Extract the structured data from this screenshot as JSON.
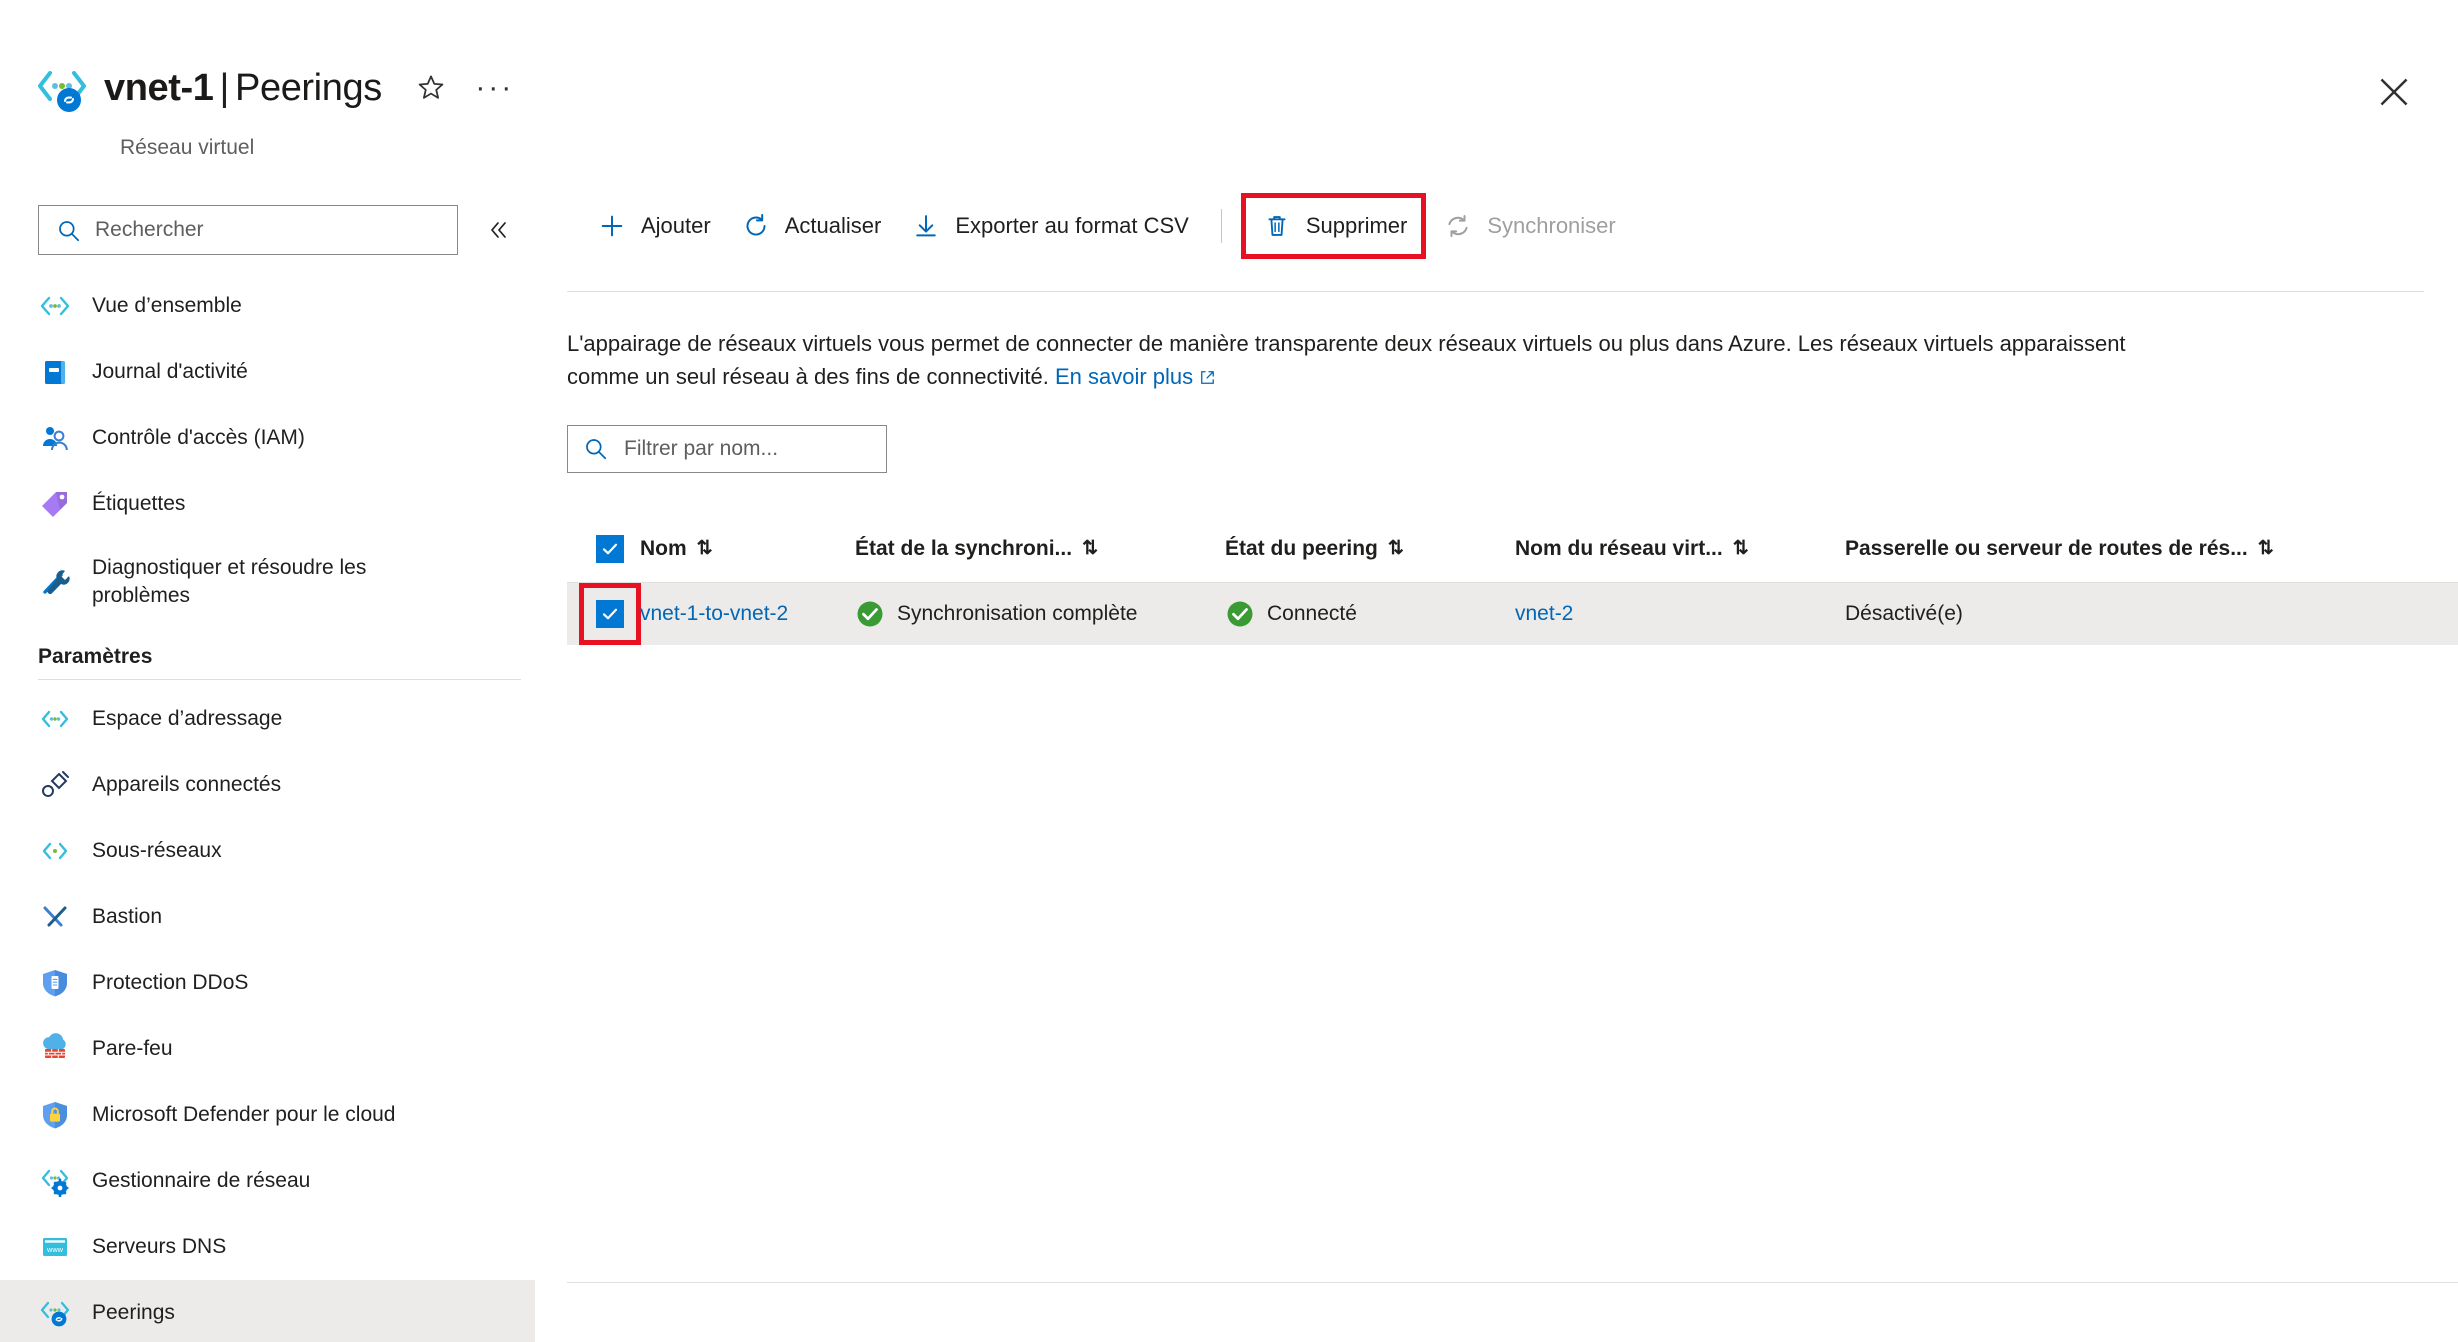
{
  "header": {
    "resource_name": "vnet-1",
    "separator": "|",
    "page_name": "Peerings",
    "subtitle": "Réseau virtuel",
    "favorite_icon": "star-icon",
    "more_icon": "ellipsis-icon",
    "close_icon": "close-icon"
  },
  "sidebar": {
    "search_placeholder": "Rechercher",
    "search_value": "",
    "collapse_icon": "double-chevron-left-icon",
    "items": [
      {
        "label": "Vue d’ensemble",
        "icon": "virtual-network-icon",
        "selected": false
      },
      {
        "label": "Journal d'activité",
        "icon": "activity-log-icon",
        "selected": false
      },
      {
        "label": "Contrôle d'accès (IAM)",
        "icon": "access-control-icon",
        "selected": false
      },
      {
        "label": "Étiquettes",
        "icon": "tag-icon",
        "selected": false
      },
      {
        "label": "Diagnostiquer et résoudre les problèmes",
        "icon": "troubleshoot-icon",
        "selected": false
      }
    ],
    "group_label": "Paramètres",
    "settings_items": [
      {
        "label": "Espace d’adressage",
        "icon": "address-space-icon",
        "selected": false
      },
      {
        "label": "Appareils connectés",
        "icon": "connected-devices-icon",
        "selected": false
      },
      {
        "label": "Sous-réseaux",
        "icon": "subnet-icon",
        "selected": false
      },
      {
        "label": "Bastion",
        "icon": "bastion-icon",
        "selected": false
      },
      {
        "label": "Protection DDoS",
        "icon": "ddos-shield-icon",
        "selected": false
      },
      {
        "label": "Pare-feu",
        "icon": "firewall-icon",
        "selected": false
      },
      {
        "label": "Microsoft Defender pour le cloud",
        "icon": "defender-shield-icon",
        "selected": false
      },
      {
        "label": "Gestionnaire de réseau",
        "icon": "network-manager-icon",
        "selected": false
      },
      {
        "label": "Serveurs DNS",
        "icon": "dns-server-icon",
        "selected": false
      },
      {
        "label": "Peerings",
        "icon": "peerings-icon",
        "selected": true
      }
    ]
  },
  "toolbar": {
    "add_label": "Ajouter",
    "refresh_label": "Actualiser",
    "export_label": "Exporter au format CSV",
    "delete_label": "Supprimer",
    "sync_label": "Synchroniser",
    "add_icon": "plus-icon",
    "refresh_icon": "refresh-icon",
    "export_icon": "download-icon",
    "delete_icon": "trash-icon",
    "sync_icon": "sync-icon",
    "highlight_color": "#e81123"
  },
  "description": {
    "text": "L'appairage de réseaux virtuels vous permet de connecter de manière transparente deux réseaux virtuels ou plus dans Azure. Les réseaux virtuels apparaissent comme un seul réseau à des fins de connectivité.",
    "link_label": "En savoir plus",
    "link_icon": "external-link-icon"
  },
  "filter": {
    "placeholder": "Filtrer par nom...",
    "value": "",
    "icon": "search-icon"
  },
  "table": {
    "select_all_checked": true,
    "columns": [
      {
        "label": "Nom",
        "sort_icon": "sort-icon"
      },
      {
        "label": "État de la synchroni...",
        "sort_icon": "sort-icon"
      },
      {
        "label": "État du peering",
        "sort_icon": "sort-icon"
      },
      {
        "label": "Nom du réseau virt...",
        "sort_icon": "sort-icon"
      },
      {
        "label": "Passerelle ou serveur de routes de rés...",
        "sort_icon": "sort-icon"
      }
    ],
    "rows": [
      {
        "checked": true,
        "name": "vnet-1-to-vnet-2",
        "sync_state": "Synchronisation complète",
        "sync_icon": "check-circle-icon",
        "peering_state": "Connecté",
        "peering_icon": "check-circle-icon",
        "remote_vnet": "vnet-2",
        "gateway": "Désactivé(e)"
      }
    ],
    "status_color": "#3a9b35",
    "accent_color": "#0078d4"
  }
}
